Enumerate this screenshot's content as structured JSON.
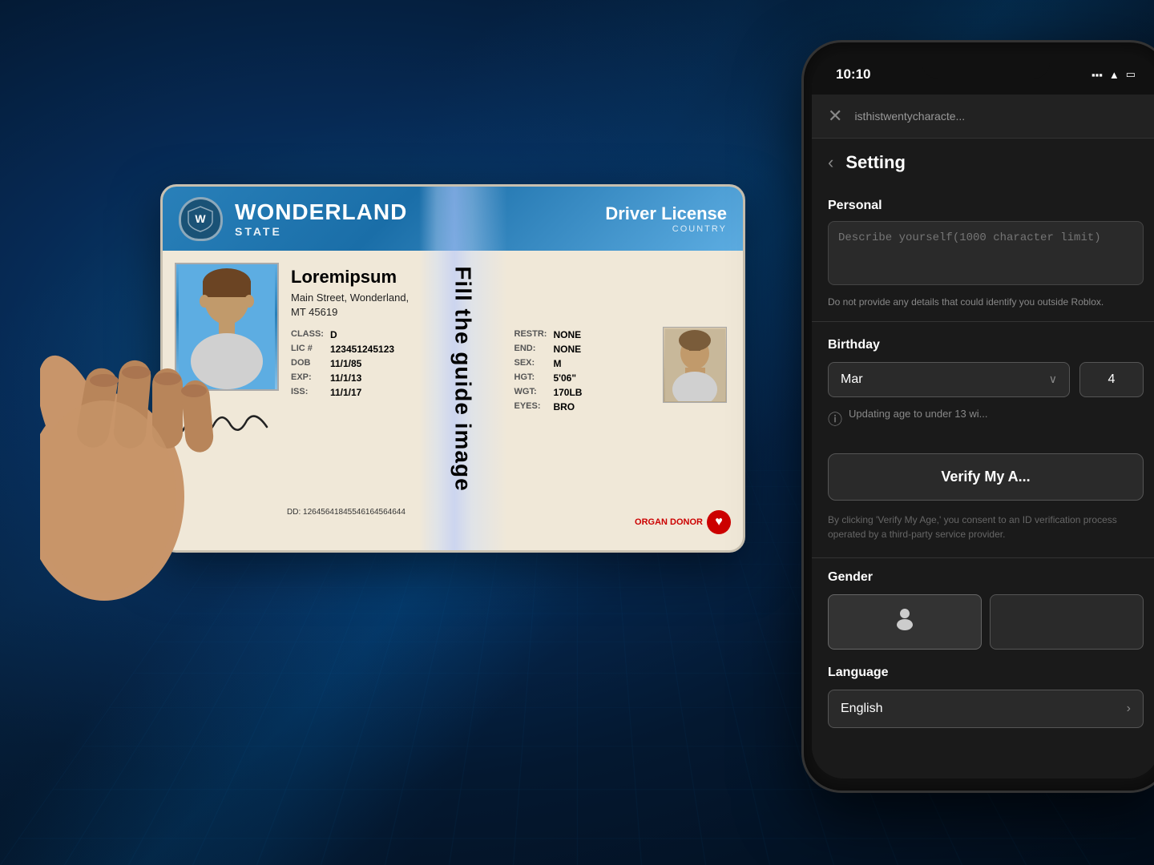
{
  "background": {
    "color_primary": "#041830",
    "color_secondary": "#0a4a7a"
  },
  "id_card": {
    "header": {
      "state_name": "WONDERLAND",
      "state_sub": "STATE",
      "license_type": "Driver License",
      "country": "COUNTRY"
    },
    "guide_text": "Fill the guide image",
    "holder": {
      "name": "Loremipsum",
      "address_line1": "Main Street, Wonderland,",
      "address_line2": "MT 45619",
      "class_label": "CLASS:",
      "class_value": "D",
      "lic_label": "LIC #",
      "lic_value": "123451245123",
      "dob_label": "DOB",
      "dob_value": "11/1/85",
      "exp_label": "EXP:",
      "exp_value": "11/1/13",
      "iss_label": "ISS:",
      "iss_value": "11/1/17",
      "restr_label": "RESTR:",
      "restr_value": "NONE",
      "end_label": "END:",
      "end_value": "NONE",
      "sex_label": "SEX:",
      "sex_value": "M",
      "hgt_label": "HGT:",
      "hgt_value": "5'06\"",
      "wgt_label": "WGT:",
      "wgt_value": "170LB",
      "eyes_label": "EYES:",
      "eyes_value": "BRO",
      "dd_label": "DD:",
      "dd_value": "12645641845546164564644",
      "organ_donor": "ORGAN DONOR",
      "signature": "~luxtune~"
    }
  },
  "phone": {
    "status_bar": {
      "time": "10:10"
    },
    "top_bar": {
      "close_label": "✕",
      "username": "isthistwentycharacte..."
    },
    "settings_header": {
      "back_label": "‹",
      "title": "Setting"
    },
    "personal_section": {
      "label": "Personal",
      "describe_placeholder": "Describe yourself(1000 character limit)",
      "warning": "Do not provide any details that could identify you outside Roblox."
    },
    "birthday_section": {
      "label": "Birthday",
      "month_value": "Mar",
      "day_value": "4",
      "age_warning": "Updating age to under 13 wi..."
    },
    "verify_button": {
      "label": "Verify My A..."
    },
    "verify_disclaimer": "By clicking 'Verify My Age,' you consent to an ID verification process operated by a third-party service provider.",
    "gender_section": {
      "label": "Gender"
    },
    "language_section": {
      "label": "Language",
      "value": "English"
    }
  }
}
